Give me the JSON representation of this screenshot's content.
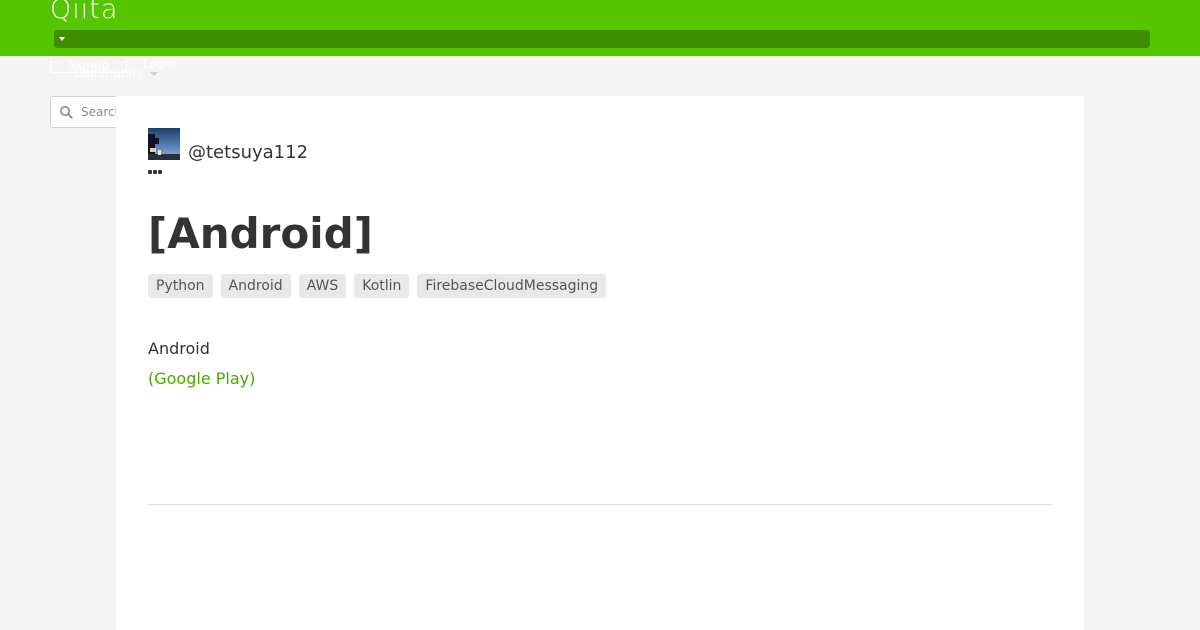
{
  "header": {
    "logo": "Qiita",
    "brand_color": "#55c500",
    "menu_bar_color": "#3e8f00",
    "menu_icon": "caret-down-icon"
  },
  "auth": {
    "signup_label": "Signup",
    "login_label": "Login"
  },
  "nav": {
    "community_label": "Community",
    "community_icon": "chevron-down-icon"
  },
  "search": {
    "placeholder": "Search",
    "icon": "search-icon"
  },
  "article": {
    "author": "@tetsuya112",
    "more_icon": "more-dots-icon",
    "title": "[Android]",
    "tags": [
      "Python",
      "Android",
      "AWS",
      "Kotlin",
      "FirebaseCloudMessaging"
    ],
    "body_line": "Android",
    "body_link": "(Google Play)",
    "link_color": "#4aa800"
  }
}
